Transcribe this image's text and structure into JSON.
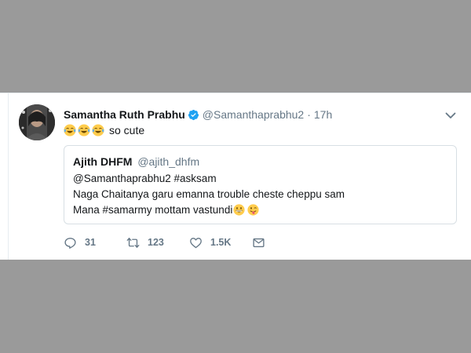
{
  "tweet": {
    "author_name": "Samantha Ruth Prabhu",
    "author_handle": "@Samanthaprabhu2",
    "separator": "·",
    "time": "17h",
    "text": "so cute",
    "emojis": [
      "face-with-tears-of-joy",
      "face-with-tears-of-joy",
      "face-with-tears-of-joy"
    ]
  },
  "quote": {
    "author_name": "Ajith DHFM",
    "author_handle": "@ajith_dhfm",
    "line1": "@Samanthaprabhu2  #asksam",
    "line2": "Naga Chaitanya garu emanna trouble cheste cheppu sam",
    "line3": "Mana #samarmy mottam vastundi",
    "line3_emojis": [
      "grinning-face",
      "winking-face-with-tongue"
    ]
  },
  "actions": {
    "reply_count": "31",
    "retweet_count": "123",
    "like_count": "1.5K"
  },
  "colors": {
    "background": "#9a9a9a",
    "card": "#ffffff",
    "text": "#14171a",
    "muted": "#657786",
    "verified": "#1da1f2",
    "border": "#e6ecf0"
  }
}
